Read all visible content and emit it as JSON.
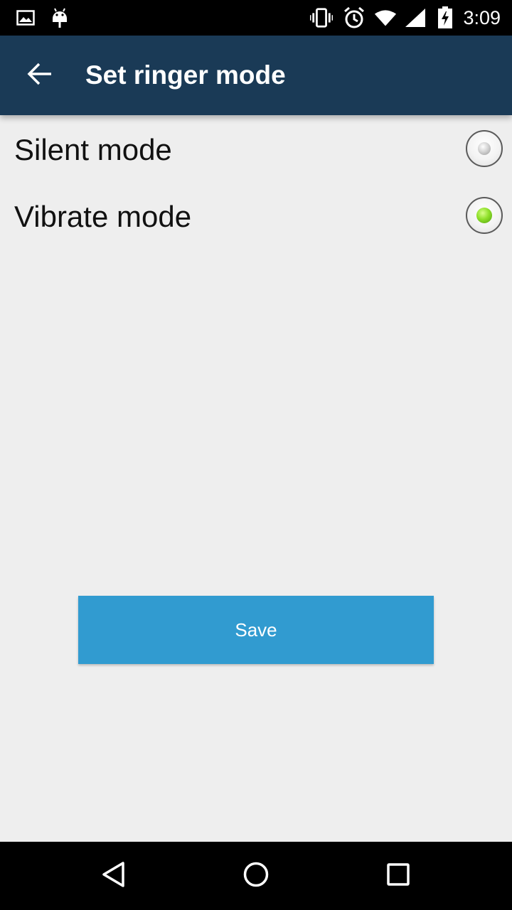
{
  "status_bar": {
    "time": "3:09",
    "icons": [
      "image-icon",
      "android-icon",
      "vibrate-icon",
      "alarm-icon",
      "wifi-icon",
      "signal-icon",
      "battery-charging-icon"
    ]
  },
  "app_bar": {
    "title": "Set ringer mode",
    "back_icon": "arrow-back-icon",
    "background_color": "#1a3a56"
  },
  "options": [
    {
      "label": "Silent mode",
      "selected": false
    },
    {
      "label": "Vibrate mode",
      "selected": true
    }
  ],
  "save_button": {
    "label": "Save",
    "color": "#319bd0"
  },
  "nav_bar": {
    "icons": [
      "back-triangle-icon",
      "home-circle-icon",
      "recents-square-icon"
    ]
  }
}
